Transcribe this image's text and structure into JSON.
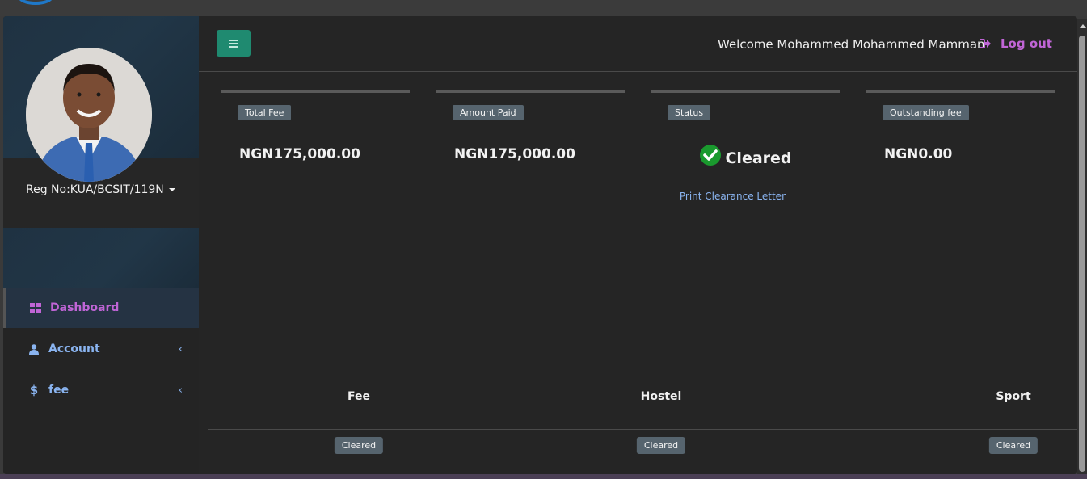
{
  "header": {
    "welcome_text": "Welcome Mohammed Mohammed Mamman",
    "logout_label": "Log out",
    "menu_button_icon": "hamburger-icon",
    "logout_icon": "sign-out-icon"
  },
  "sidebar": {
    "reg_no": "Reg No:KUA/BCSIT/119N",
    "items": [
      {
        "label": "Dashboard",
        "icon": "dashboard-grid-icon",
        "active": true
      },
      {
        "label": "Account",
        "icon": "user-icon",
        "active": false
      },
      {
        "label": "fee",
        "icon": "dollar-icon",
        "active": false
      }
    ]
  },
  "cards": {
    "total_fee": {
      "label": "Total Fee",
      "value": "NGN175,000.00"
    },
    "amount_paid": {
      "label": "Amount Paid",
      "value": "NGN175,000.00"
    },
    "status": {
      "label": "Status",
      "value": "Cleared",
      "link": "Print Clearance Letter"
    },
    "outstanding": {
      "label": "Outstanding fee",
      "value": "NGN0.00"
    }
  },
  "clearance_table": {
    "headers": [
      "Fee",
      "Hostel",
      "Sport"
    ],
    "values": [
      "Cleared",
      "Cleared",
      "Cleared"
    ]
  },
  "colors": {
    "accent_purple": "#c065d6",
    "link_blue": "#8ab4f0",
    "menu_button": "#1f8a70",
    "badge": "#56646e",
    "success": "#1a9a2e"
  }
}
